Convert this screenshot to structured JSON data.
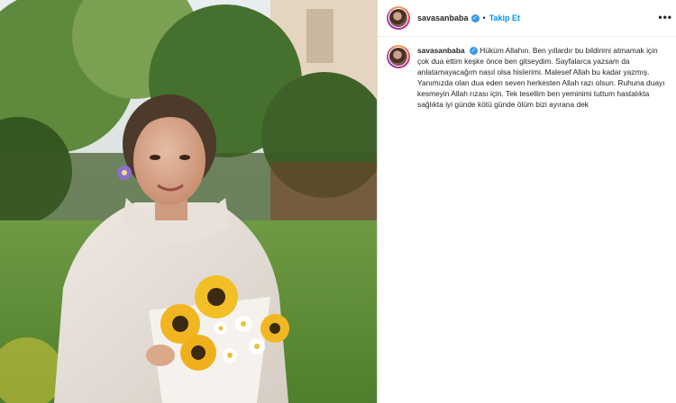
{
  "post": {
    "username": "savasanbaba",
    "follow_label": "Takip Et",
    "separator": "•",
    "more_label": "•••",
    "verified_mark": "✓",
    "caption": "Hüküm Allahın. Ben yıllardır bu bildirimi atmamak için çok dua ettim keşke önce ben gitseydim. Sayfalarca yazsam da anlatamayacağım nasıl olsa hislerimi. Malesef Allah bu kadar yazmış. Yanımızda olan dua eden seven herkesten Allah razı olsun. Ruhuna duayı kesmeyin Allah rızası için. Tek tesellim ben yeminimi tuttum hastalıkta sağlıkta iyi günde kötü günde ölüm bizi ayırana dek"
  },
  "colors": {
    "link_blue": "#0095f6",
    "verified_blue": "#3897f0",
    "text": "#262626"
  },
  "icons": [
    "verified-badge-icon",
    "more-options-icon",
    "avatar"
  ]
}
